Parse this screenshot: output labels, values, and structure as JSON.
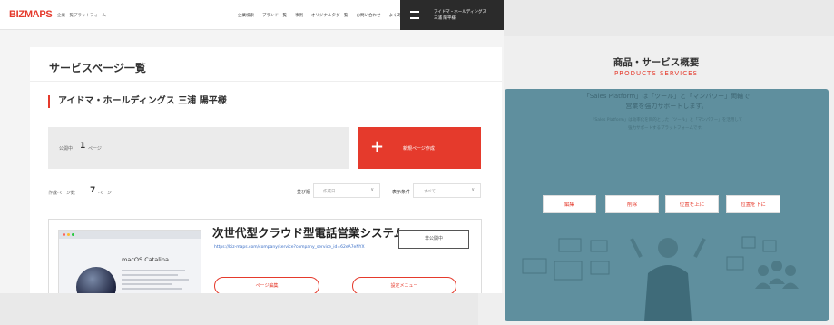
{
  "right_panel": {
    "title": "商品・サービス概要",
    "subtitle": "PRODUCTS SERVICES",
    "headline_line1": "「Sales Platform」は「ツール」と「マンパワー」両輪で",
    "headline_line2": "営業を強力サポートします。",
    "body_line1": "「Sales Platform」は効率化を目的とした「ツール」と「マンパワー」を活用して",
    "body_line2": "強力サポートするプラットフォームです。",
    "buttons": [
      "編集",
      "削除",
      "位置を上に",
      "位置を下に"
    ]
  },
  "header": {
    "logo": "BIZMAPS",
    "logo_tagline": "企業一覧プラットフォーム",
    "nav_links": [
      "企業検索",
      "ブランド一覧",
      "事例",
      "オリジナルタグ一覧",
      "お問い合わせ",
      "よくある質問"
    ],
    "user_line1": "アイドマ・ホールディングス",
    "user_line2": "三浦 陽平様"
  },
  "main": {
    "page_title": "サービスページ一覧",
    "company": "アイドマ・ホールディングス 三浦 陽平様",
    "published_label": "公開中",
    "published_count": "1",
    "published_unit": "ページ",
    "new_button": "新規ページ作成",
    "new_button_icon": "plus-icon",
    "created_label": "作成ページ数",
    "created_count": "7",
    "created_unit": "ページ",
    "sort_label": "並び順",
    "sort_value": "作成日",
    "display_label": "表示条件",
    "display_value": "すべて"
  },
  "card": {
    "title": "次世代型クラウド型電話営業システム",
    "url": "https://biz-maps.com/company/service?company_service_id=62eA7eNYX",
    "status": "非公開中",
    "edit_button": "ページ編集",
    "settings_button": "設定メニュー",
    "thumb_os": "macOS Catalina"
  },
  "colors": {
    "accent": "#e53a2c",
    "overlay": "#5f8f9e",
    "header_dark": "#2b2b2b"
  }
}
